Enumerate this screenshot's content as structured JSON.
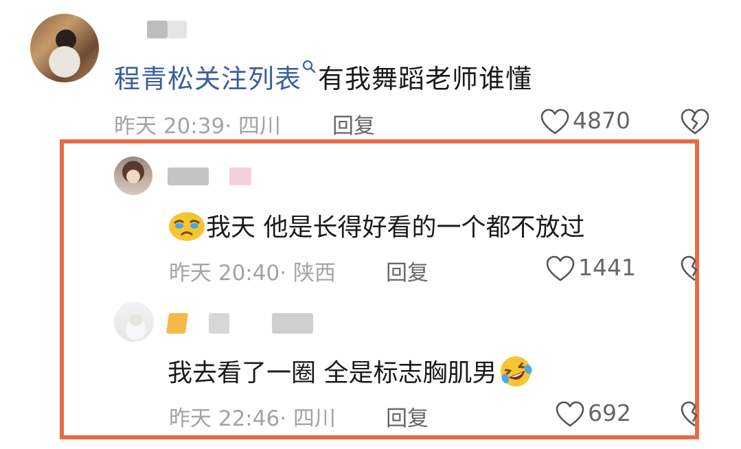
{
  "main_comment": {
    "link_text": "程青松关注列表",
    "body_text": "有我舞蹈老师谁懂",
    "time": "昨天 20:39",
    "location": "四川",
    "reply_label": "回复",
    "likes": "4870"
  },
  "replies": [
    {
      "text": "我天 他是长得好看的一个都不放过",
      "emoji_name": "crying-face-emoji",
      "time": "昨天 20:40",
      "location": "陕西",
      "reply_label": "回复",
      "likes": "1441"
    },
    {
      "text": "我去看了一圈  全是标志胸肌男",
      "emoji_name": "rolling-laughing-emoji",
      "time": "昨天 22:46",
      "location": "四川",
      "reply_label": "回复",
      "likes": "692"
    }
  ],
  "colors": {
    "link": "#3a5d9c",
    "highlight_border": "#e76b45",
    "meta_text": "#a3a3a3"
  }
}
